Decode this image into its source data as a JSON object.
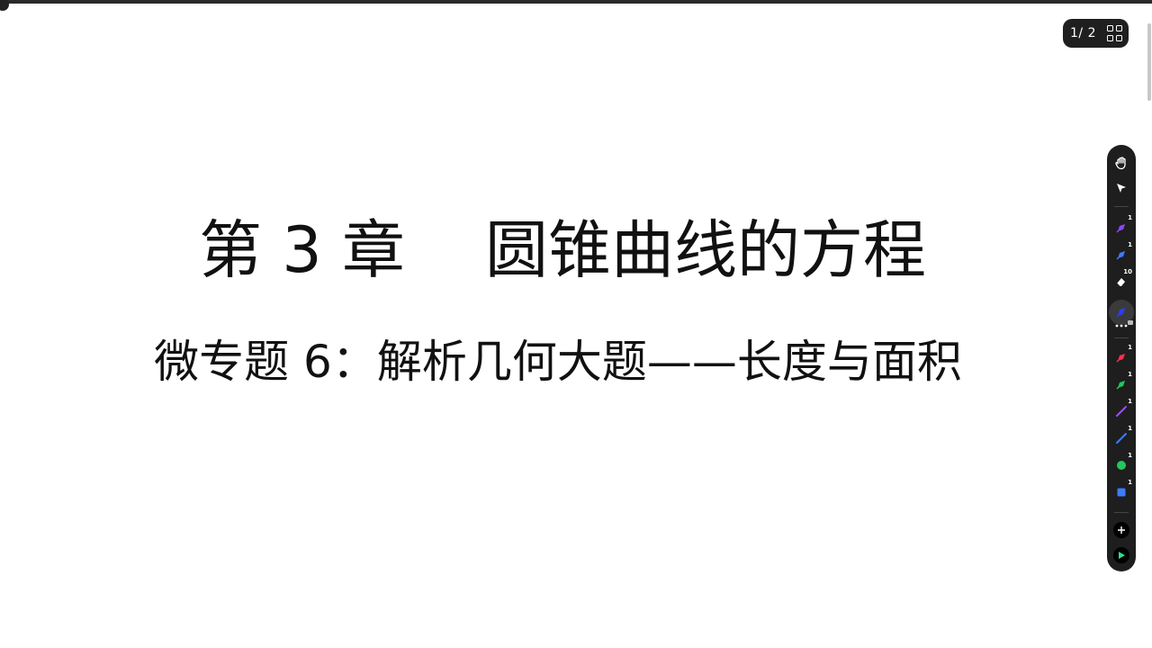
{
  "slide": {
    "title": "第 3 章    圆锥曲线的方程",
    "subtitle": "微专题 6：解析几何大题——长度与面积"
  },
  "page_indicator": {
    "text": "1/ 2"
  },
  "toolbar": {
    "tools": [
      {
        "name": "hand-tool",
        "icon": "hand-icon"
      },
      {
        "name": "select-tool",
        "icon": "cursor-arrow-icon"
      },
      {
        "name": "purple-highlighter",
        "icon": "highlighter-icon",
        "color": "#8e44ff",
        "badge": "1"
      },
      {
        "name": "blue-highlighter",
        "icon": "highlighter-icon",
        "color": "#3d7bff",
        "badge": "1"
      },
      {
        "name": "eraser",
        "icon": "eraser-icon",
        "color": "#ffffff",
        "badge": "10"
      },
      {
        "name": "blue-pen",
        "icon": "pen-icon",
        "color": "#2b3cff"
      },
      {
        "name": "more-options",
        "icon": "more-horizontal-icon"
      },
      {
        "name": "red-highlighter",
        "icon": "highlighter-icon",
        "color": "#ff2e4d",
        "badge": "1"
      },
      {
        "name": "green-highlighter",
        "icon": "highlighter-icon",
        "color": "#20c95a",
        "badge": "1"
      },
      {
        "name": "purple-line",
        "icon": "line-icon",
        "color": "#9a4dff",
        "badge": "1"
      },
      {
        "name": "blue-line",
        "icon": "line-icon",
        "color": "#3d7bff",
        "badge": "1"
      },
      {
        "name": "green-circle",
        "icon": "circle-icon",
        "color": "#20c95a",
        "badge": "1"
      },
      {
        "name": "blue-square",
        "icon": "square-icon",
        "color": "#3d7bff",
        "badge": "1"
      },
      {
        "name": "add-tool",
        "icon": "plus-icon"
      },
      {
        "name": "expand-toolbar",
        "icon": "play-arrow-icon",
        "color": "#2ee08a"
      }
    ]
  }
}
